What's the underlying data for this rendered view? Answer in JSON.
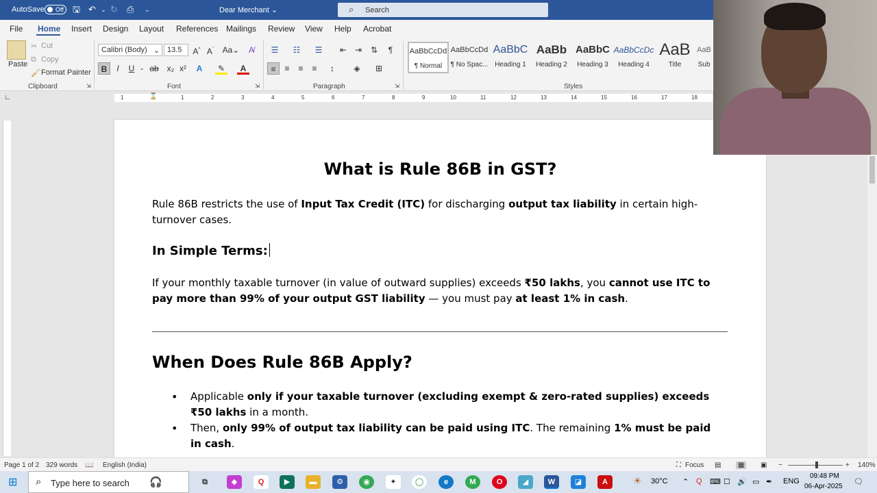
{
  "titlebar": {
    "autosave_label": "AutoSave",
    "autosave_state": "Off",
    "document_name": "Dear Merchant",
    "search_placeholder": "Search"
  },
  "menu": [
    "File",
    "Home",
    "Insert",
    "Design",
    "Layout",
    "References",
    "Mailings",
    "Review",
    "View",
    "Help",
    "Acrobat"
  ],
  "ribbon": {
    "clipboard": {
      "paste": "Paste",
      "cut": "Cut",
      "copy": "Copy",
      "format_painter": "Format Painter",
      "label": "Clipboard"
    },
    "font": {
      "family": "Calibri (Body)",
      "size": "13.5",
      "label": "Font"
    },
    "paragraph": {
      "label": "Paragraph"
    },
    "styles": {
      "label": "Styles",
      "items": [
        {
          "preview": "AaBbCcDd",
          "name": "¶ Normal"
        },
        {
          "preview": "AaBbCcDd",
          "name": "¶ No Spac..."
        },
        {
          "preview": "AaBbC",
          "name": "Heading 1"
        },
        {
          "preview": "AaBb",
          "name": "Heading 2"
        },
        {
          "preview": "AaBbC",
          "name": "Heading 3"
        },
        {
          "preview": "AaBbCcDc",
          "name": "Heading 4"
        },
        {
          "preview": "AaB",
          "name": "Title"
        },
        {
          "preview": "AaB",
          "name": "Sub"
        }
      ]
    }
  },
  "ruler": {
    "ticks": [
      "1",
      "1",
      "2",
      "3",
      "4",
      "5",
      "6",
      "7",
      "8",
      "9",
      "10",
      "11",
      "12",
      "13",
      "14",
      "15",
      "16",
      "17",
      "18"
    ]
  },
  "document": {
    "title": "What is Rule 86B in GST?",
    "intro": {
      "p1": "Rule 86B restricts the use of ",
      "b1": "Input Tax Credit (ITC)",
      "p2": " for discharging ",
      "b2": "output tax liability",
      "p3": " in certain high-turnover cases."
    },
    "simple_heading": "In Simple Terms:",
    "simple": {
      "p1": "If your monthly taxable turnover (in value of outward supplies) exceeds ",
      "b1": "₹50 lakhs",
      "p2": ", you ",
      "b2": "cannot use ITC to pay more than 99% of your output GST liability",
      "p3": " — you must pay ",
      "b3": "at least 1% in cash",
      "p4": "."
    },
    "apply_heading": "When Does Rule 86B Apply?",
    "bullet1": {
      "p1": "Applicable ",
      "b1": "only if your taxable turnover (excluding exempt & zero-rated supplies) exceeds ₹50 lakhs",
      "p2": " in a month."
    },
    "bullet2": {
      "p1": "Then, ",
      "b1": "only 99% of output tax liability can be paid using ITC",
      "p2": ". The remaining ",
      "b2": "1% must be paid in cash",
      "p3": "."
    }
  },
  "status": {
    "page": "Page 1 of 2",
    "words": "329 words",
    "language": "English (India)",
    "focus": "Focus",
    "zoom": "140%"
  },
  "taskbar": {
    "search_placeholder": "Type here to search",
    "temperature": "30°C",
    "lang": "ENG",
    "time": "09:48 PM",
    "date": "06-Apr-2025"
  }
}
